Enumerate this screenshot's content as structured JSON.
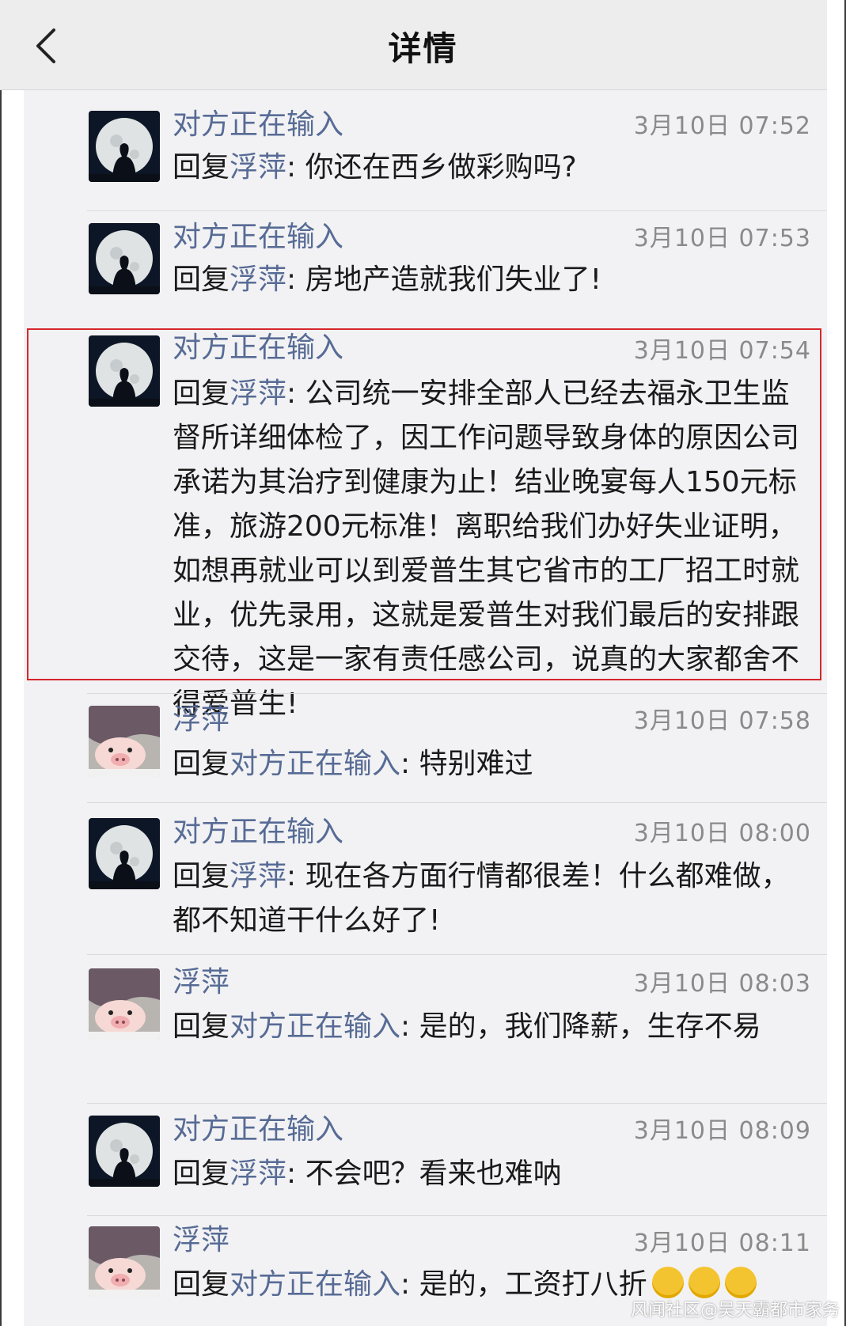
{
  "navbar": {
    "title": "详情"
  },
  "reply_prefix": "回复",
  "colon": ":",
  "messages": [
    {
      "sender": "对方正在输入",
      "avatar": "moon-silhouette-avatar",
      "time": "3月10日 07:52",
      "reply_to": "浮萍",
      "text": "你还在西乡做彩购吗?"
    },
    {
      "sender": "对方正在输入",
      "avatar": "moon-silhouette-avatar",
      "time": "3月10日 07:53",
      "reply_to": "浮萍",
      "text": "房地产造就我们失业了!"
    },
    {
      "sender": "对方正在输入",
      "avatar": "moon-silhouette-avatar",
      "time": "3月10日 07:54",
      "reply_to": "浮萍",
      "text": "公司统一安排全部人已经去福永卫生监督所详细体检了，因工作问题导致身体的原因公司承诺为其治疗到健康为止！结业晚宴每人150元标准，旅游200元标准！离职给我们办好失业证明，如想再就业可以到爱普生其它省市的工厂招工时就业，优先录用，这就是爱普生对我们最后的安排跟交待，这是一家有责任感公司，说真的大家都舍不得爱普生!"
    },
    {
      "sender": "浮萍",
      "avatar": "pig-avatar",
      "time": "3月10日 07:58",
      "reply_to": "对方正在输入",
      "text": "特别难过"
    },
    {
      "sender": "对方正在输入",
      "avatar": "moon-silhouette-avatar",
      "time": "3月10日 08:00",
      "reply_to": "浮萍",
      "text": "现在各方面行情都很差！什么都难做，都不知道干什么好了!"
    },
    {
      "sender": "浮萍",
      "avatar": "pig-avatar",
      "time": "3月10日 08:03",
      "reply_to": "对方正在输入",
      "text": "是的，我们降薪，生存不易"
    },
    {
      "sender": "对方正在输入",
      "avatar": "moon-silhouette-avatar",
      "time": "3月10日 08:09",
      "reply_to": "浮萍",
      "text": "不会吧？看来也难呐"
    },
    {
      "sender": "浮萍",
      "avatar": "pig-avatar",
      "time": "3月10日 08:11",
      "reply_to": "对方正在输入",
      "text": "是的，工资打八折"
    }
  ],
  "watermark": "风闻社区@吴天霸都市家务",
  "colors": {
    "name_link": "#576b95",
    "highlight_border": "#d6262c",
    "time": "#8a8a8a"
  }
}
